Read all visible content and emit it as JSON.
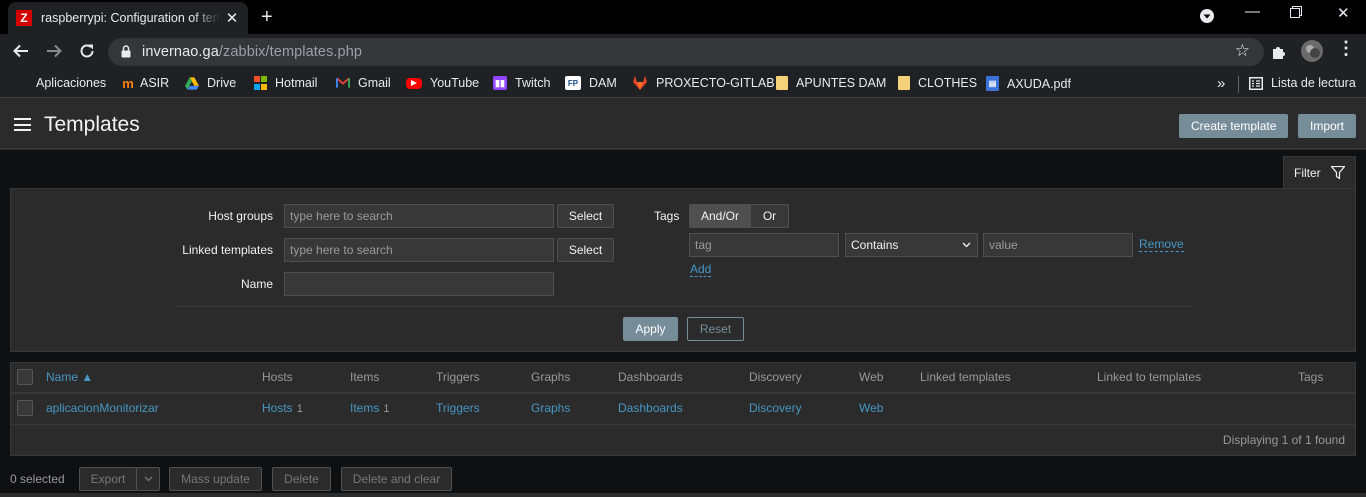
{
  "browser": {
    "tab_title": "raspberrypi: Configuration of templates",
    "tab_favicon": "Z",
    "url_host": "invernao.ga",
    "url_path": "/zabbix/templates.php",
    "bookmarks": [
      {
        "label": "Aplicaciones",
        "icon": "apps-grid-icon"
      },
      {
        "label": "ASIR",
        "icon": "moodle-icon"
      },
      {
        "label": "Drive",
        "icon": "drive-icon"
      },
      {
        "label": "Hotmail",
        "icon": "microsoft-icon"
      },
      {
        "label": "Gmail",
        "icon": "gmail-icon"
      },
      {
        "label": "YouTube",
        "icon": "youtube-icon"
      },
      {
        "label": "Twitch",
        "icon": "twitch-icon"
      },
      {
        "label": "DAM",
        "icon": "fp-icon"
      },
      {
        "label": "PROXECTO-GITLAB",
        "icon": "gitlab-icon"
      },
      {
        "label": "APUNTES DAM",
        "icon": "folder-icon"
      },
      {
        "label": "CLOTHES",
        "icon": "folder-icon"
      },
      {
        "label": "AXUDA.pdf",
        "icon": "pdf-icon"
      }
    ],
    "overflow_label": "»",
    "reading_list": "Lista de lectura"
  },
  "header": {
    "title": "Templates",
    "create_label": "Create template",
    "import_label": "Import"
  },
  "filter": {
    "tab_label": "Filter",
    "host_groups_label": "Host groups",
    "linked_templates_label": "Linked templates",
    "name_label": "Name",
    "search_placeholder": "type here to search",
    "select_label": "Select",
    "tags_label": "Tags",
    "and_or_label": "And/Or",
    "or_label": "Or",
    "tag_placeholder": "tag",
    "operator_value": "Contains",
    "value_placeholder": "value",
    "remove_label": "Remove",
    "add_label": "Add",
    "apply_label": "Apply",
    "reset_label": "Reset"
  },
  "table": {
    "headers": {
      "name": "Name ▲",
      "hosts": "Hosts",
      "items": "Items",
      "triggers": "Triggers",
      "graphs": "Graphs",
      "dashboards": "Dashboards",
      "discovery": "Discovery",
      "web": "Web",
      "linked_templates": "Linked templates",
      "linked_to_templates": "Linked to templates",
      "tags": "Tags"
    },
    "row": {
      "name": "aplicacionMonitorizar",
      "hosts": "Hosts",
      "hosts_count": "1",
      "items": "Items",
      "items_count": "1",
      "triggers": "Triggers",
      "graphs": "Graphs",
      "dashboards": "Dashboards",
      "discovery": "Discovery",
      "web": "Web"
    },
    "footer": "Displaying 1 of 1 found"
  },
  "actions": {
    "selected": "0 selected",
    "export": "Export",
    "mass_update": "Mass update",
    "delete": "Delete",
    "delete_clear": "Delete and clear"
  },
  "colors": {
    "link": "#4796c4",
    "primary_button": "#768d99",
    "panel": "#2b2b2b",
    "background": "#0e1012"
  }
}
